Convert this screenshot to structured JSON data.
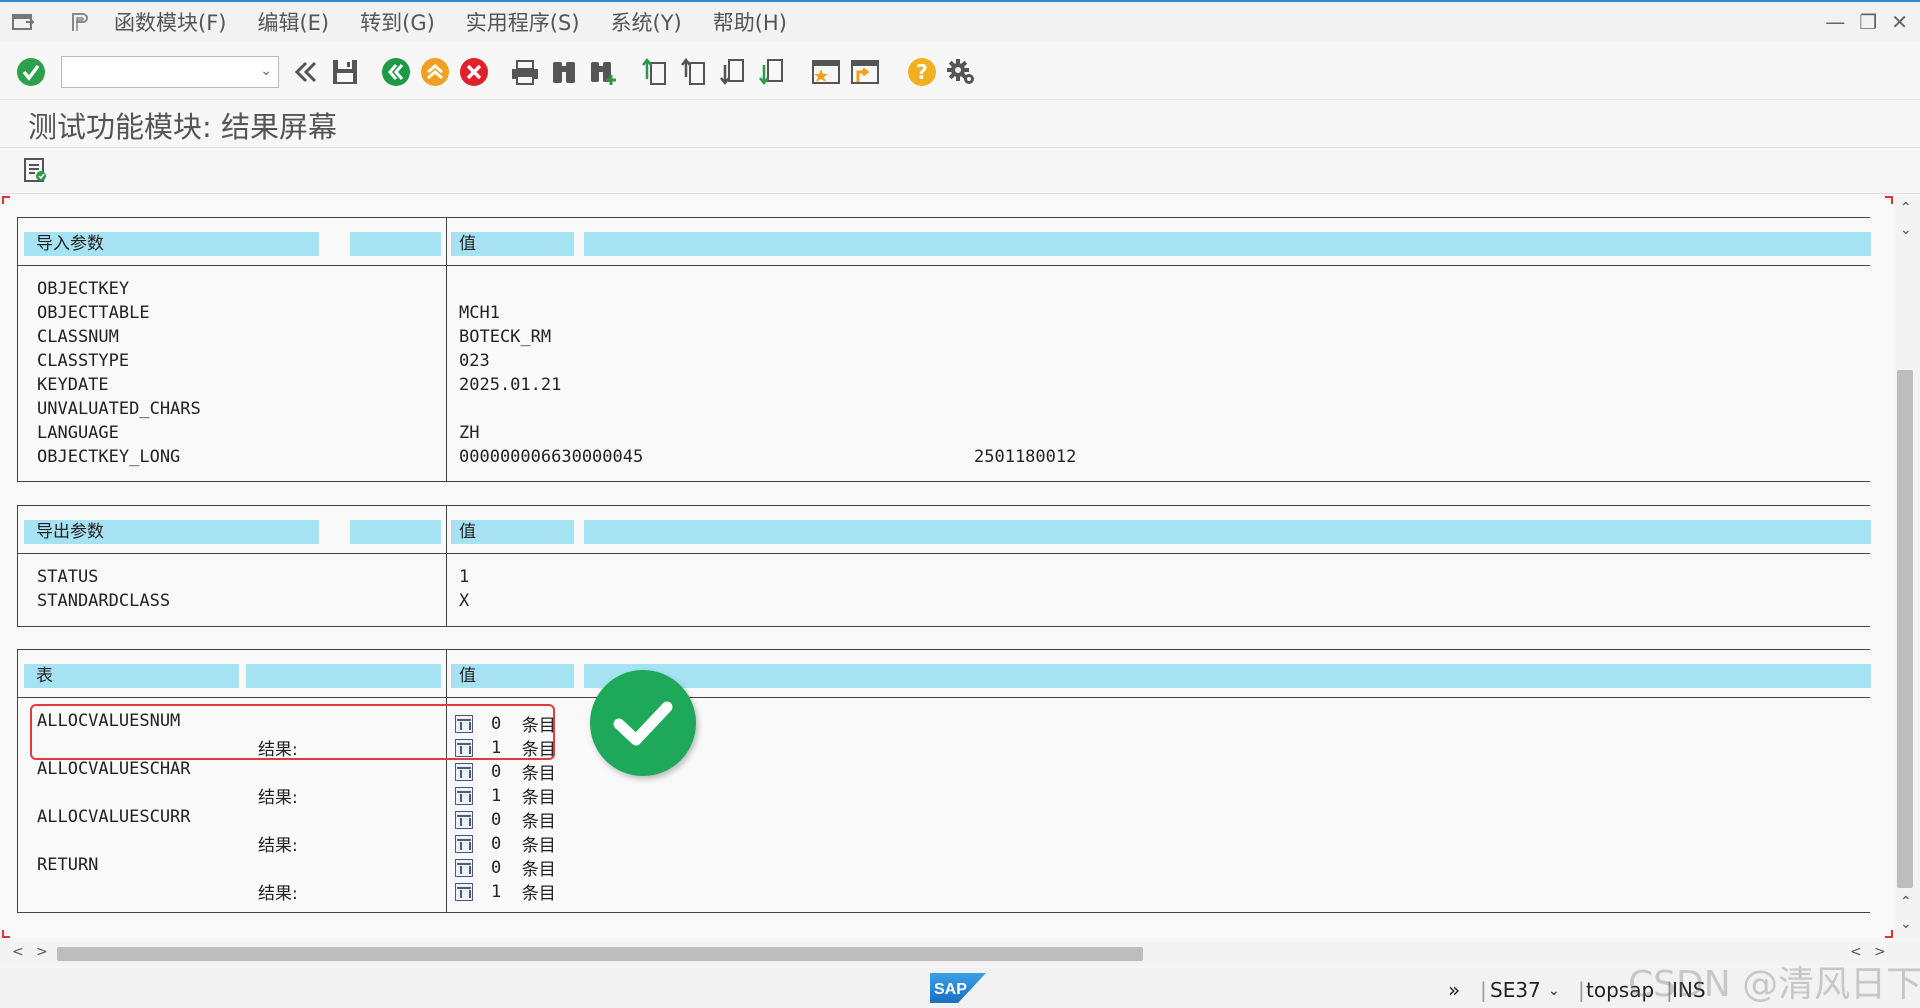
{
  "menu": {
    "items": [
      "函数模块(F)",
      "编辑(E)",
      "转到(G)",
      "实用程序(S)",
      "系统(Y)",
      "帮助(H)"
    ]
  },
  "title": "测试功能模块: 结果屏幕",
  "import": {
    "header_name": "导入参数",
    "header_value": "值",
    "params": [
      {
        "name": "OBJECTKEY",
        "value": ""
      },
      {
        "name": "OBJECTTABLE",
        "value": "MCH1"
      },
      {
        "name": "CLASSNUM",
        "value": "BOTECK_RM"
      },
      {
        "name": "CLASSTYPE",
        "value": "023"
      },
      {
        "name": "KEYDATE",
        "value": "2025.01.21"
      },
      {
        "name": "UNVALUATED_CHARS",
        "value": ""
      },
      {
        "name": "LANGUAGE",
        "value": "ZH"
      },
      {
        "name": "OBJECTKEY_LONG",
        "value": "000000006630000045",
        "value2": "2501180012"
      }
    ]
  },
  "export": {
    "header_name": "导出参数",
    "header_value": "值",
    "params": [
      {
        "name": "STATUS",
        "value": "1"
      },
      {
        "name": "STANDARDCLASS",
        "value": "X"
      }
    ]
  },
  "tables": {
    "header_name": "表",
    "header_value": "值",
    "result_label": "结果:",
    "entries_unit": "条目",
    "rows": [
      {
        "name": "ALLOCVALUESNUM",
        "before": "0",
        "after": "1"
      },
      {
        "name": "ALLOCVALUESCHAR",
        "before": "0",
        "after": "1"
      },
      {
        "name": "ALLOCVALUESCURR",
        "before": "0",
        "after": "0"
      },
      {
        "name": "RETURN",
        "before": "0",
        "after": "1"
      }
    ]
  },
  "status": {
    "transaction": "SE37",
    "user": "topsap",
    "mode": "INS"
  },
  "watermark": "CSDN @清风日下",
  "colors": {
    "header_bg": "#a6e3f2",
    "accent": "#2f8ad8",
    "check_green": "#1ea95a",
    "highlight_red": "#e23b3b"
  }
}
